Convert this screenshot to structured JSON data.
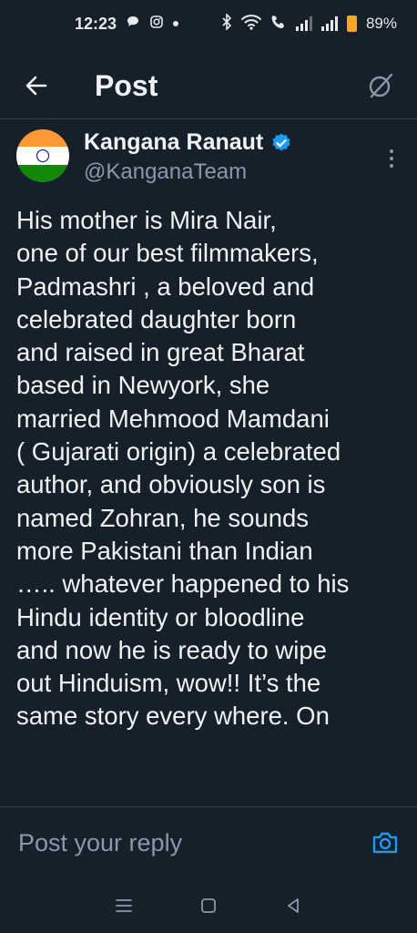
{
  "status_bar": {
    "time": "12:23",
    "battery_percent": "89%",
    "icons": [
      "chat-bubble-icon",
      "instagram-icon",
      "dot-icon",
      "bluetooth-icon",
      "wifi-icon",
      "wifi-calling-icon",
      "signal-icon",
      "signal-icon",
      "battery-icon"
    ],
    "battery_color": "#f5a623"
  },
  "header": {
    "title": "Post",
    "back_icon": "arrow-left-icon",
    "right_icon": "grok-icon"
  },
  "author": {
    "display_name": "Kangana Ranaut",
    "handle": "@KanganaTeam",
    "verified": true,
    "verified_color": "#1d9bf0",
    "avatar": "india-flag-avatar"
  },
  "tweet": {
    "text": "His mother is Mira Nair,\none of our best filmmakers,\nPadmashri , a beloved and\ncelebrated daughter born\nand raised in great Bharat\nbased in Newyork, she\nmarried Mehmood Mamdani\n( Gujarati origin) a celebrated\nauthor, and obviously son is\nnamed Zohran, he sounds\nmore Pakistani than Indian\n….. whatever happened to his\nHindu identity or bloodline\nand now he is ready to wipe\nout Hinduism, wow!! It’s the\nsame story every where. On"
  },
  "reply": {
    "placeholder": "Post your reply",
    "camera_icon": "camera-icon",
    "accent": "#1d9bf0"
  },
  "nav_bar": {
    "icons": [
      "menu-icon",
      "home-square-icon",
      "back-triangle-icon"
    ]
  },
  "colors": {
    "background": "#15202b",
    "text": "#e7e9ea",
    "muted": "#8b98a5"
  }
}
